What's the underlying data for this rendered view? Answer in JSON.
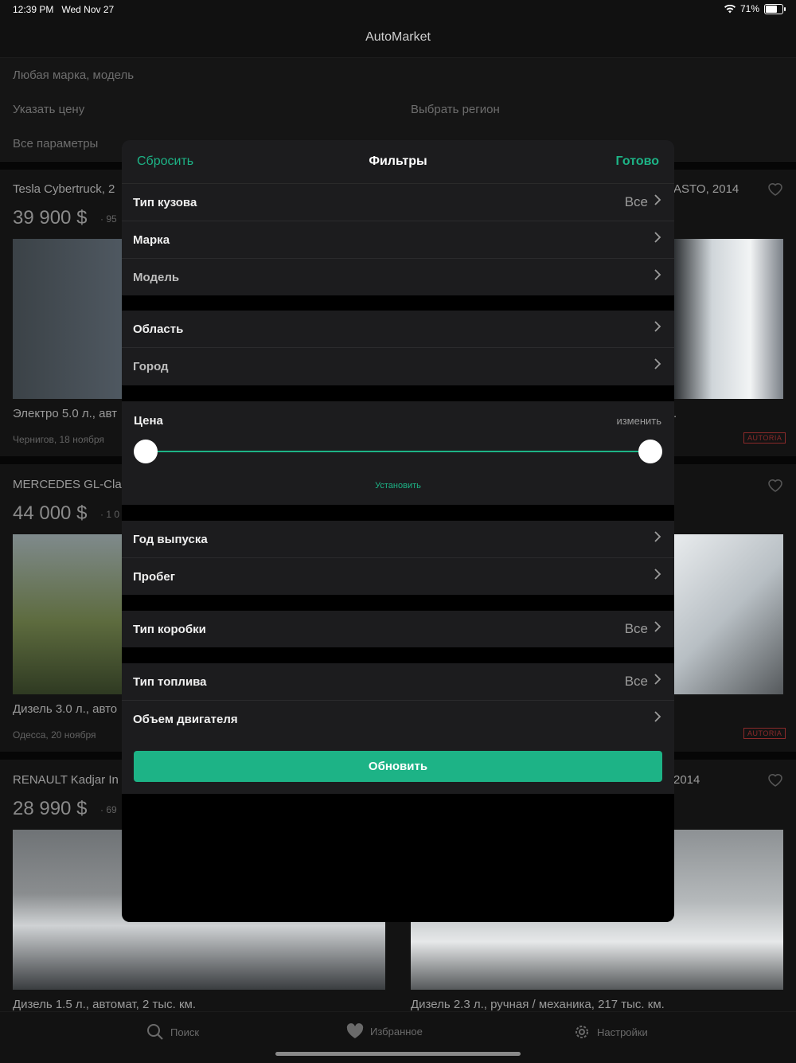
{
  "status": {
    "time": "12:39 PM",
    "date": "Wed Nov 27",
    "battery": "71%"
  },
  "app_title": "AutoMarket",
  "search": {
    "brand_model": "Любая марка, модель",
    "price": "Указать цену",
    "region": "Выбрать регион",
    "all_params": "Все параметры"
  },
  "listings": [
    {
      "title": "Tesla Cybertruck, 2",
      "price": "39 900 $",
      "extra": "· 95",
      "desc": "Электро 5.0 л., авт",
      "meta": "Чернигов, 18 ноября"
    },
    {
      "title": "ASTO, 2014",
      "desc": ".",
      "badge": "AUTORIA"
    },
    {
      "title": "MERCEDES GL-Cla",
      "price": "44 000 $",
      "extra": "· 1 0",
      "desc": "Дизель 3.0 л., авто",
      "meta": "Одесса, 20 ноября"
    },
    {
      "title": "",
      "badge": "AUTORIA"
    },
    {
      "title": "RENAULT Kadjar In",
      "price": "28 990 $",
      "extra": "· 69",
      "desc": "Дизель 1.5 л., автомат, 2 тыс. км."
    },
    {
      "title": "2014",
      "desc": "Дизель 2.3 л., ручная / механика, 217 тыс. км."
    }
  ],
  "tabs": {
    "search": "Поиск",
    "favorites": "Избранное",
    "settings": "Настройки"
  },
  "modal": {
    "reset": "Сбросить",
    "title": "Фильтры",
    "done": "Готово",
    "body_type": {
      "label": "Тип кузова",
      "value": "Все"
    },
    "brand": {
      "label": "Марка"
    },
    "model": {
      "label": "Модель"
    },
    "region": {
      "label": "Область"
    },
    "city": {
      "label": "Город"
    },
    "price": {
      "label": "Цена",
      "change": "изменить",
      "set": "Установить",
      "range": [
        0,
        1
      ]
    },
    "year": {
      "label": "Год выпуска"
    },
    "mileage": {
      "label": "Пробег"
    },
    "gearbox": {
      "label": "Тип коробки",
      "value": "Все"
    },
    "fuel": {
      "label": "Тип топлива",
      "value": "Все"
    },
    "engine": {
      "label": "Объем двигателя"
    },
    "update_button": "Обновить"
  },
  "colors": {
    "accent": "#1db386"
  }
}
